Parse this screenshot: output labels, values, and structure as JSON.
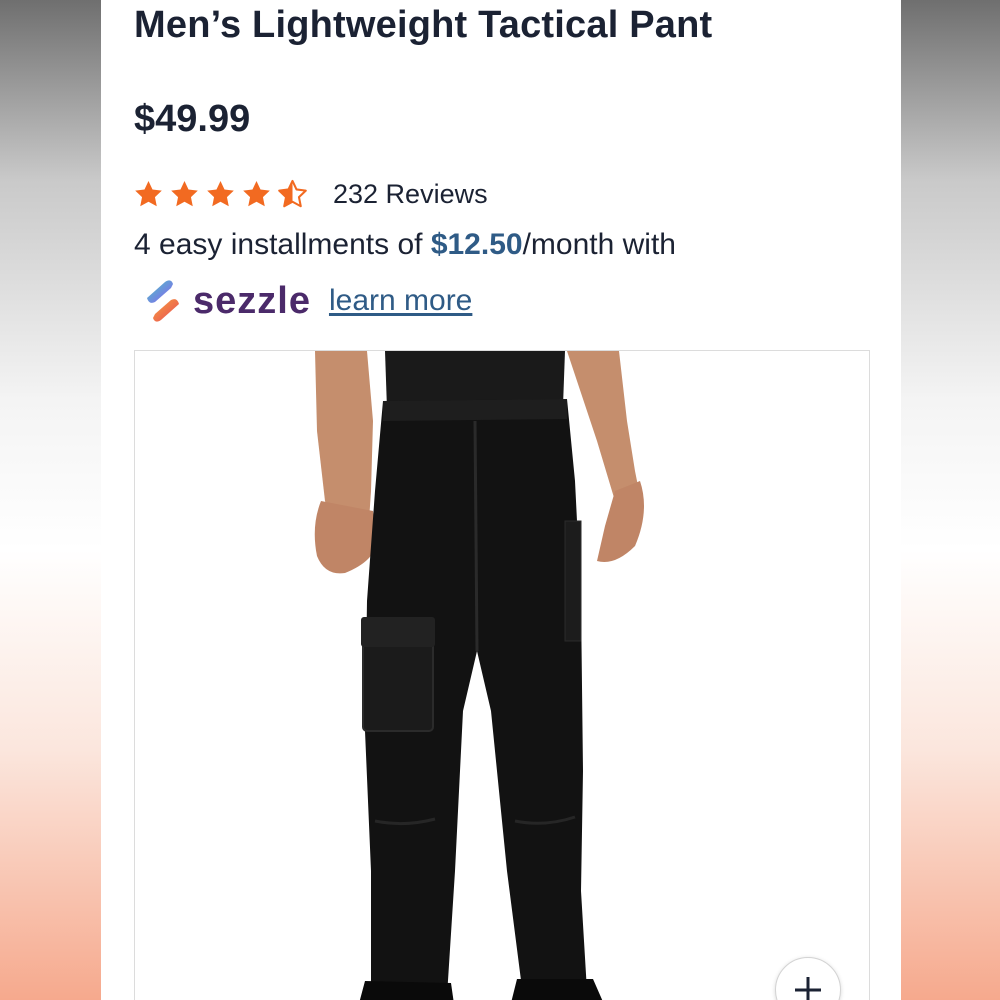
{
  "product": {
    "title": "Men’s Lightweight Tactical Pant",
    "price": "$49.99",
    "rating": {
      "value": 4.5,
      "max": 5,
      "reviews_label": "232 Reviews"
    },
    "installments": {
      "prefix": "4 easy installments of ",
      "amount": "$12.50",
      "suffix": "/month with"
    },
    "sezzle": {
      "brand": "sezzle",
      "link_label": "learn more"
    },
    "image": {
      "icon": "zoom-plus-icon"
    }
  },
  "colors": {
    "star": "#f26a21",
    "text": "#1b2233",
    "accent": "#2f5b86",
    "sezzle": "#4b2a6a"
  }
}
